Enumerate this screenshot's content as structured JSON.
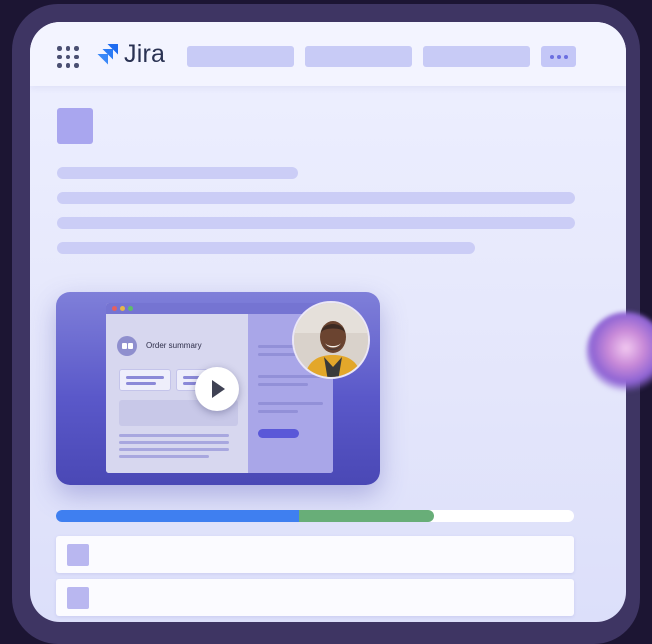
{
  "app": {
    "brand_name": "Jira",
    "menu_icon": "app-grid-icon",
    "logo_icon": "jira-logo-icon",
    "more_icon": "ellipsis-icon"
  },
  "nav": {
    "items": [
      "",
      "",
      ""
    ]
  },
  "video": {
    "window_title": "Order summary",
    "play_icon": "play-icon",
    "presenter_icon": "presenter-avatar"
  },
  "progress": {
    "blue_fraction": 0.47,
    "green_fraction": 0.26,
    "colors": {
      "blue": "#3f7ff0",
      "green": "#68ae78",
      "track": "#ffffff"
    }
  },
  "list": {
    "rows": [
      {
        "label": ""
      },
      {
        "label": ""
      }
    ]
  },
  "colors": {
    "accent": "#6b6fe0",
    "placeholder": "#cbcdf6",
    "background": "#1c1533"
  }
}
